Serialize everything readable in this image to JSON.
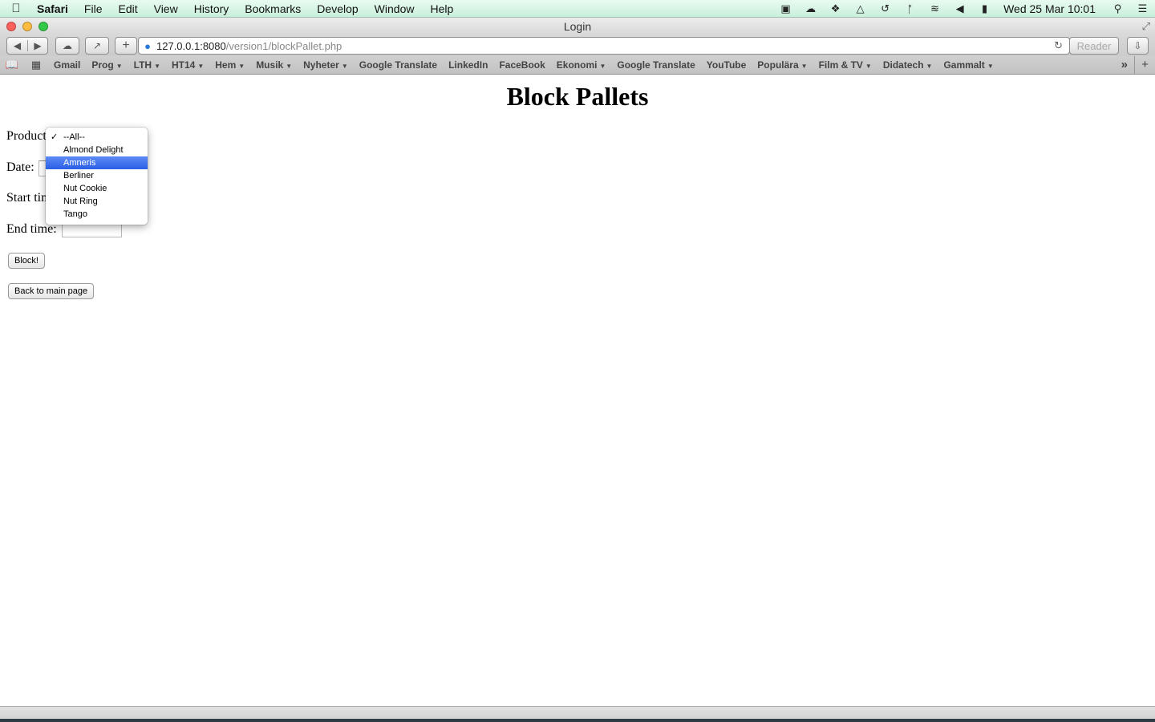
{
  "menubar": {
    "app_name": "Safari",
    "items": [
      "File",
      "Edit",
      "View",
      "History",
      "Bookmarks",
      "Develop",
      "Window",
      "Help"
    ],
    "clock": "Wed 25 Mar  10:01"
  },
  "window": {
    "title": "Login"
  },
  "toolbar": {
    "url_host": "127.0.0.1:8080",
    "url_path": "/version1/blockPallet.php",
    "reader_label": "Reader"
  },
  "bookmarks": [
    {
      "label": "Gmail",
      "folder": false
    },
    {
      "label": "Prog",
      "folder": true
    },
    {
      "label": "LTH",
      "folder": true
    },
    {
      "label": "HT14",
      "folder": true
    },
    {
      "label": "Hem",
      "folder": true
    },
    {
      "label": "Musik",
      "folder": true
    },
    {
      "label": "Nyheter",
      "folder": true
    },
    {
      "label": "Google Translate",
      "folder": false
    },
    {
      "label": "LinkedIn",
      "folder": false
    },
    {
      "label": "FaceBook",
      "folder": false
    },
    {
      "label": "Ekonomi",
      "folder": true
    },
    {
      "label": "Google Translate",
      "folder": false
    },
    {
      "label": "YouTube",
      "folder": false
    },
    {
      "label": "Populära",
      "folder": true
    },
    {
      "label": "Film & TV",
      "folder": true
    },
    {
      "label": "Didatech",
      "folder": true
    },
    {
      "label": "Gammalt",
      "folder": true
    }
  ],
  "page": {
    "heading": "Block Pallets",
    "product_label": "Product",
    "date_label": "Date:",
    "start_label": "Start tim",
    "end_label": "End time:",
    "block_button": "Block!",
    "back_button": "Back to main page"
  },
  "product_dropdown": {
    "checked_value": "--All--",
    "highlighted_value": "Amneris",
    "options": [
      "--All--",
      "Almond Delight",
      "Amneris",
      "Berliner",
      "Nut Cookie",
      "Nut Ring",
      "Tango"
    ]
  }
}
